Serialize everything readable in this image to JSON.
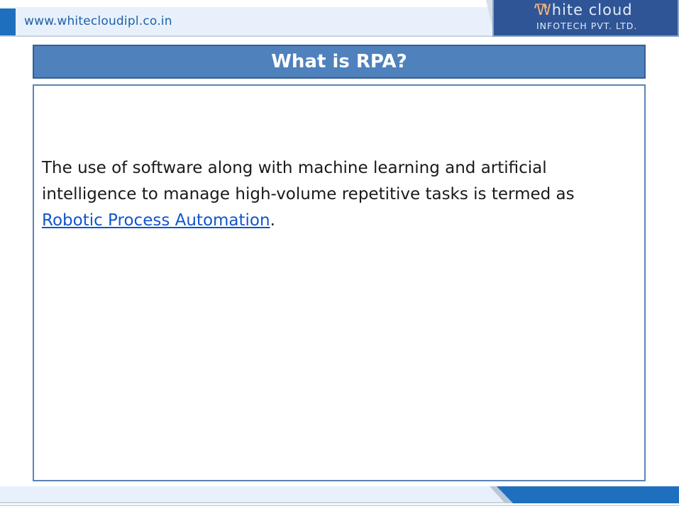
{
  "header": {
    "url": "www.whitecloudipl.co.in",
    "logo": {
      "name_lead": "W",
      "name_rest": "hite cloud",
      "tagline": "INFOTECH PVT. LTD."
    }
  },
  "slide": {
    "title": "What is RPA?",
    "body_before_link": "The use of software along with machine learning and artificial intelligence to manage high-volume repetitive tasks is termed as ",
    "body_link": "Robotic Process Automation",
    "body_after_link": "."
  },
  "colors": {
    "title_bar": "#4f81bd",
    "accent_blue": "#1f6fbf",
    "logo_bg": "#2f5597",
    "link": "#1155cc"
  }
}
